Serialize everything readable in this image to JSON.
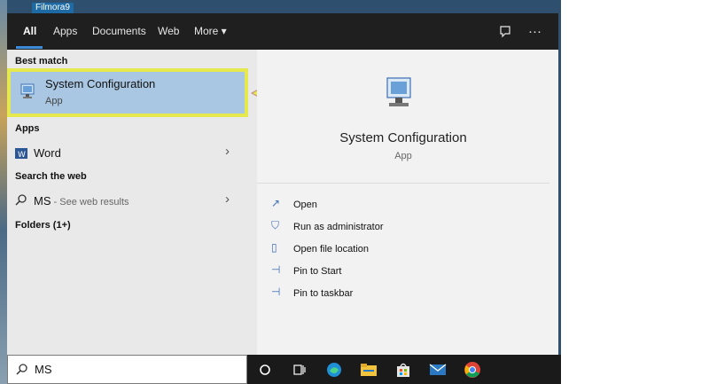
{
  "watermark": "Filmora9",
  "top_tabs": [
    "All",
    "Apps",
    "Documents",
    "Web",
    "More ▾"
  ],
  "left": {
    "best_match_heading": "Best match",
    "best_match": {
      "title": "System Configuration",
      "subtitle": "App"
    },
    "apps_heading": "Apps",
    "apps": [
      {
        "label": "Word"
      }
    ],
    "web_heading": "Search the web",
    "web_item": {
      "query": "MS",
      "suffix": " - See web results"
    },
    "folders_heading": "Folders (1+)"
  },
  "preview": {
    "title": "System Configuration",
    "subtitle": "App",
    "actions": [
      {
        "label": "Open",
        "icon": "open-icon"
      },
      {
        "label": "Run as administrator",
        "icon": "shield-icon"
      },
      {
        "label": "Open file location",
        "icon": "folder-location-icon"
      },
      {
        "label": "Pin to Start",
        "icon": "pin-icon"
      },
      {
        "label": "Pin to taskbar",
        "icon": "pin-icon"
      }
    ]
  },
  "search": {
    "value": "MS"
  },
  "colors": {
    "highlight": "#a9c7e3",
    "annotation": "#e5e94e",
    "accent": "#3b8bd8"
  }
}
